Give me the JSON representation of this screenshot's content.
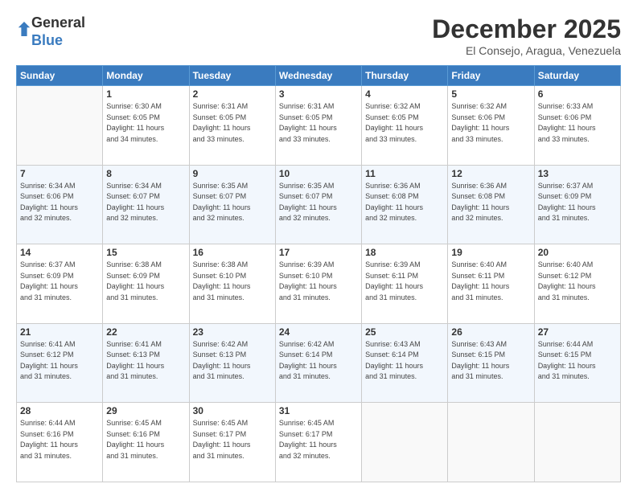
{
  "logo": {
    "general": "General",
    "blue": "Blue"
  },
  "header": {
    "month": "December 2025",
    "location": "El Consejo, Aragua, Venezuela"
  },
  "weekdays": [
    "Sunday",
    "Monday",
    "Tuesday",
    "Wednesday",
    "Thursday",
    "Friday",
    "Saturday"
  ],
  "weeks": [
    [
      {
        "day": "",
        "info": ""
      },
      {
        "day": "1",
        "info": "Sunrise: 6:30 AM\nSunset: 6:05 PM\nDaylight: 11 hours\nand 34 minutes."
      },
      {
        "day": "2",
        "info": "Sunrise: 6:31 AM\nSunset: 6:05 PM\nDaylight: 11 hours\nand 33 minutes."
      },
      {
        "day": "3",
        "info": "Sunrise: 6:31 AM\nSunset: 6:05 PM\nDaylight: 11 hours\nand 33 minutes."
      },
      {
        "day": "4",
        "info": "Sunrise: 6:32 AM\nSunset: 6:05 PM\nDaylight: 11 hours\nand 33 minutes."
      },
      {
        "day": "5",
        "info": "Sunrise: 6:32 AM\nSunset: 6:06 PM\nDaylight: 11 hours\nand 33 minutes."
      },
      {
        "day": "6",
        "info": "Sunrise: 6:33 AM\nSunset: 6:06 PM\nDaylight: 11 hours\nand 33 minutes."
      }
    ],
    [
      {
        "day": "7",
        "info": "Sunrise: 6:34 AM\nSunset: 6:06 PM\nDaylight: 11 hours\nand 32 minutes."
      },
      {
        "day": "8",
        "info": "Sunrise: 6:34 AM\nSunset: 6:07 PM\nDaylight: 11 hours\nand 32 minutes."
      },
      {
        "day": "9",
        "info": "Sunrise: 6:35 AM\nSunset: 6:07 PM\nDaylight: 11 hours\nand 32 minutes."
      },
      {
        "day": "10",
        "info": "Sunrise: 6:35 AM\nSunset: 6:07 PM\nDaylight: 11 hours\nand 32 minutes."
      },
      {
        "day": "11",
        "info": "Sunrise: 6:36 AM\nSunset: 6:08 PM\nDaylight: 11 hours\nand 32 minutes."
      },
      {
        "day": "12",
        "info": "Sunrise: 6:36 AM\nSunset: 6:08 PM\nDaylight: 11 hours\nand 32 minutes."
      },
      {
        "day": "13",
        "info": "Sunrise: 6:37 AM\nSunset: 6:09 PM\nDaylight: 11 hours\nand 31 minutes."
      }
    ],
    [
      {
        "day": "14",
        "info": "Sunrise: 6:37 AM\nSunset: 6:09 PM\nDaylight: 11 hours\nand 31 minutes."
      },
      {
        "day": "15",
        "info": "Sunrise: 6:38 AM\nSunset: 6:09 PM\nDaylight: 11 hours\nand 31 minutes."
      },
      {
        "day": "16",
        "info": "Sunrise: 6:38 AM\nSunset: 6:10 PM\nDaylight: 11 hours\nand 31 minutes."
      },
      {
        "day": "17",
        "info": "Sunrise: 6:39 AM\nSunset: 6:10 PM\nDaylight: 11 hours\nand 31 minutes."
      },
      {
        "day": "18",
        "info": "Sunrise: 6:39 AM\nSunset: 6:11 PM\nDaylight: 11 hours\nand 31 minutes."
      },
      {
        "day": "19",
        "info": "Sunrise: 6:40 AM\nSunset: 6:11 PM\nDaylight: 11 hours\nand 31 minutes."
      },
      {
        "day": "20",
        "info": "Sunrise: 6:40 AM\nSunset: 6:12 PM\nDaylight: 11 hours\nand 31 minutes."
      }
    ],
    [
      {
        "day": "21",
        "info": "Sunrise: 6:41 AM\nSunset: 6:12 PM\nDaylight: 11 hours\nand 31 minutes."
      },
      {
        "day": "22",
        "info": "Sunrise: 6:41 AM\nSunset: 6:13 PM\nDaylight: 11 hours\nand 31 minutes."
      },
      {
        "day": "23",
        "info": "Sunrise: 6:42 AM\nSunset: 6:13 PM\nDaylight: 11 hours\nand 31 minutes."
      },
      {
        "day": "24",
        "info": "Sunrise: 6:42 AM\nSunset: 6:14 PM\nDaylight: 11 hours\nand 31 minutes."
      },
      {
        "day": "25",
        "info": "Sunrise: 6:43 AM\nSunset: 6:14 PM\nDaylight: 11 hours\nand 31 minutes."
      },
      {
        "day": "26",
        "info": "Sunrise: 6:43 AM\nSunset: 6:15 PM\nDaylight: 11 hours\nand 31 minutes."
      },
      {
        "day": "27",
        "info": "Sunrise: 6:44 AM\nSunset: 6:15 PM\nDaylight: 11 hours\nand 31 minutes."
      }
    ],
    [
      {
        "day": "28",
        "info": "Sunrise: 6:44 AM\nSunset: 6:16 PM\nDaylight: 11 hours\nand 31 minutes."
      },
      {
        "day": "29",
        "info": "Sunrise: 6:45 AM\nSunset: 6:16 PM\nDaylight: 11 hours\nand 31 minutes."
      },
      {
        "day": "30",
        "info": "Sunrise: 6:45 AM\nSunset: 6:17 PM\nDaylight: 11 hours\nand 31 minutes."
      },
      {
        "day": "31",
        "info": "Sunrise: 6:45 AM\nSunset: 6:17 PM\nDaylight: 11 hours\nand 32 minutes."
      },
      {
        "day": "",
        "info": ""
      },
      {
        "day": "",
        "info": ""
      },
      {
        "day": "",
        "info": ""
      }
    ]
  ]
}
